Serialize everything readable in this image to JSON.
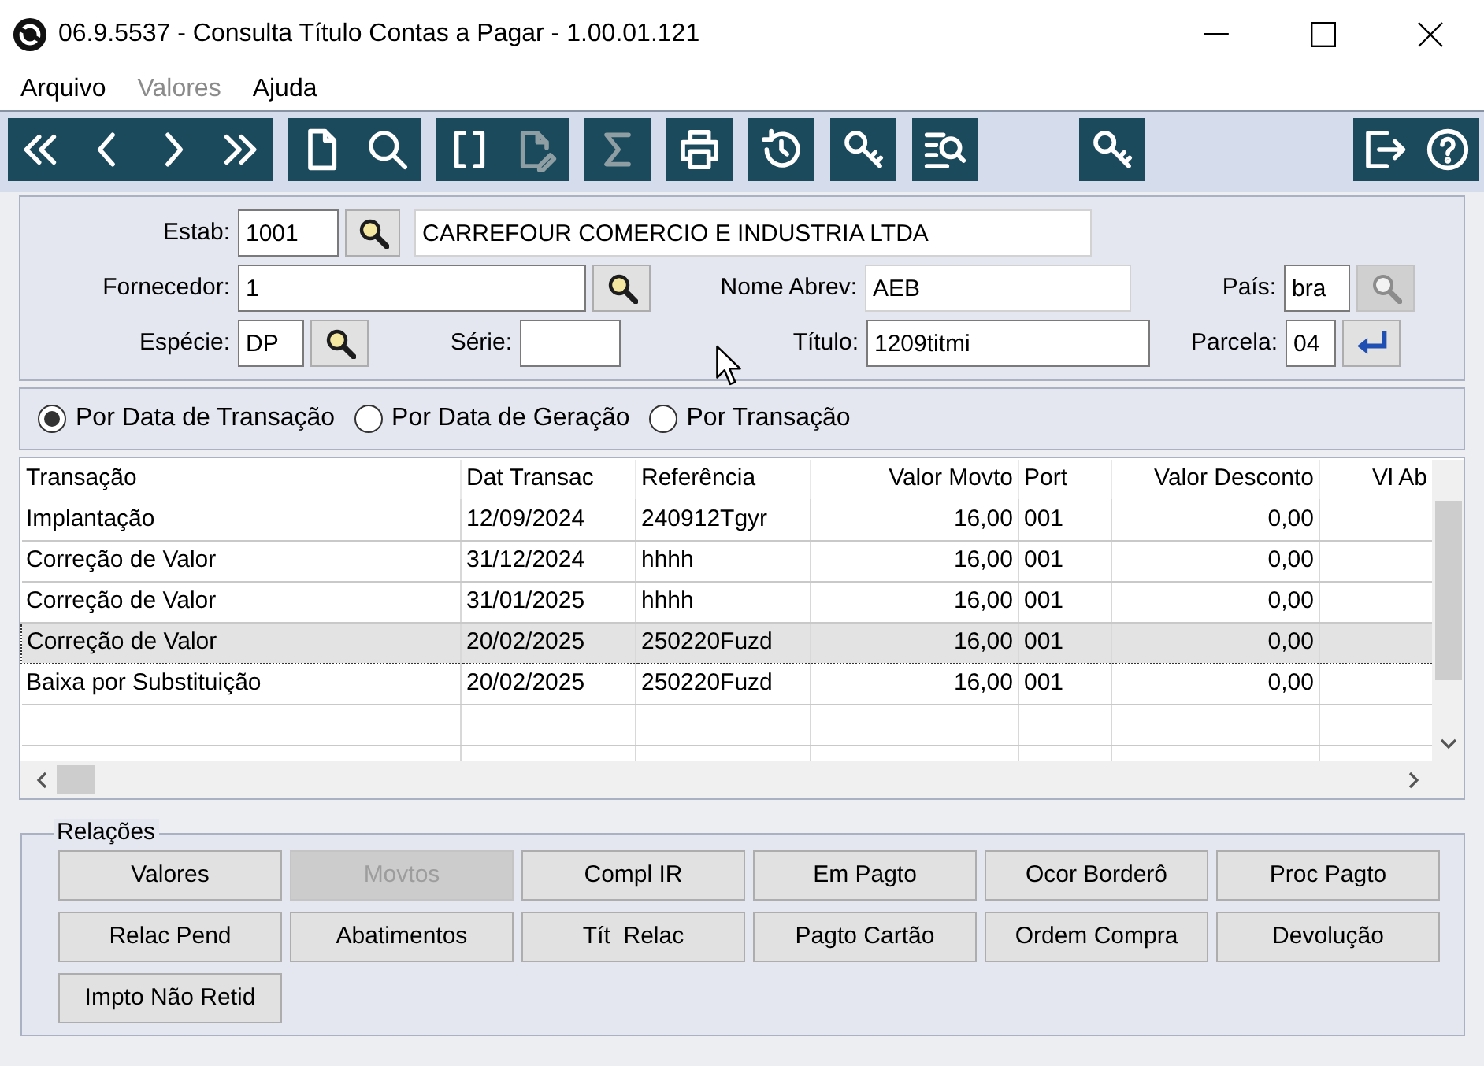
{
  "window": {
    "title": "06.9.5537 - Consulta Título Contas a Pagar - 1.00.01.121"
  },
  "menu": [
    {
      "label": "Arquivo",
      "disabled": false
    },
    {
      "label": "Valores",
      "disabled": true
    },
    {
      "label": "Ajuda",
      "disabled": false
    }
  ],
  "toolbar": [
    {
      "buttons": [
        {
          "disabled": false
        },
        {
          "disabled": false
        },
        {
          "disabled": false
        },
        {
          "disabled": false
        }
      ]
    },
    {
      "buttons": [
        {
          "disabled": false
        },
        {
          "disabled": false
        }
      ]
    },
    {
      "buttons": [
        {
          "disabled": false
        },
        {
          "disabled": true
        }
      ]
    },
    {
      "buttons": [
        {
          "disabled": true
        }
      ]
    },
    {
      "buttons": [
        {
          "disabled": false
        }
      ]
    },
    {
      "buttons": [
        {
          "disabled": false
        }
      ]
    },
    {
      "buttons": [
        {
          "disabled": false
        }
      ]
    },
    {
      "buttons": [
        {
          "disabled": false
        }
      ]
    },
    {
      "buttons": [
        {
          "disabled": false
        }
      ]
    },
    {
      "buttons": [
        {
          "disabled": false
        },
        {
          "disabled": false
        }
      ]
    }
  ],
  "form": {
    "estab": {
      "label": "Estab:",
      "value": "1001",
      "lookup_disabled": false,
      "description": "CARREFOUR COMERCIO E INDUSTRIA LTDA"
    },
    "fornecedor": {
      "label": "Fornecedor:",
      "value": "1",
      "lookup_disabled": false
    },
    "nome_abrev": {
      "label": "Nome Abrev:",
      "value": "AEB"
    },
    "pais": {
      "label": "País:",
      "value": "bra",
      "lookup_disabled": true
    },
    "especie": {
      "label": "Espécie:",
      "value": "DP",
      "lookup_disabled": false
    },
    "serie": {
      "label": "Série:"
    },
    "titulo": {
      "label": "Título:",
      "value": "1209titmi"
    },
    "parcela": {
      "label": "Parcela:",
      "value": "04"
    }
  },
  "sort_options": [
    {
      "label": "Por Data de Transação",
      "selected": true
    },
    {
      "label": "Por Data de Geração",
      "selected": false
    },
    {
      "label": "Por Transação",
      "selected": false
    }
  ],
  "table": {
    "columns": [
      {
        "label": "Transação",
        "kind": "text"
      },
      {
        "label": "Dat Transac",
        "kind": "text"
      },
      {
        "label": "Referência",
        "kind": "text"
      },
      {
        "label": "Valor Movto",
        "kind": "number"
      },
      {
        "label": "Port",
        "kind": "text"
      },
      {
        "label": "Valor Desconto",
        "kind": "number"
      },
      {
        "label": "Vl Ab",
        "kind": "number"
      }
    ],
    "rows": [
      {
        "cells": [
          "Implantação",
          "12/09/2024",
          "240912Tgyr",
          "16,00",
          "001",
          "0,00"
        ],
        "selected": false
      },
      {
        "cells": [
          "Correção de Valor",
          "31/12/2024",
          "hhhh",
          "16,00",
          "001",
          "0,00"
        ],
        "selected": false
      },
      {
        "cells": [
          "Correção de Valor",
          "31/01/2025",
          "hhhh",
          "16,00",
          "001",
          "0,00"
        ],
        "selected": false
      },
      {
        "cells": [
          "Correção de Valor",
          "20/02/2025",
          "250220Fuzd",
          "16,00",
          "001",
          "0,00"
        ],
        "selected": true
      },
      {
        "cells": [
          "Baixa por Substituição",
          "20/02/2025",
          "250220Fuzd",
          "16,00",
          "001",
          "0,00"
        ],
        "selected": false
      }
    ]
  },
  "relations": {
    "title": "Relações",
    "buttons": [
      {
        "label": "Valores",
        "disabled": false
      },
      {
        "label": "Movtos",
        "disabled": true
      },
      {
        "label": "Compl IR",
        "disabled": false
      },
      {
        "label": "Em Pagto",
        "disabled": false
      },
      {
        "label": "Ocor Borderô",
        "disabled": false
      },
      {
        "label": "Proc Pagto",
        "disabled": false
      },
      {
        "label": "Relac Pend",
        "disabled": false
      },
      {
        "label": "Abatimentos",
        "disabled": false
      },
      {
        "label": "Tít  Relac",
        "disabled": false
      },
      {
        "label": "Pagto Cartão",
        "disabled": false
      },
      {
        "label": "Ordem Compra",
        "disabled": false
      },
      {
        "label": "Devolução",
        "disabled": false
      },
      {
        "label": "Impto Não Retid",
        "disabled": false
      }
    ]
  }
}
